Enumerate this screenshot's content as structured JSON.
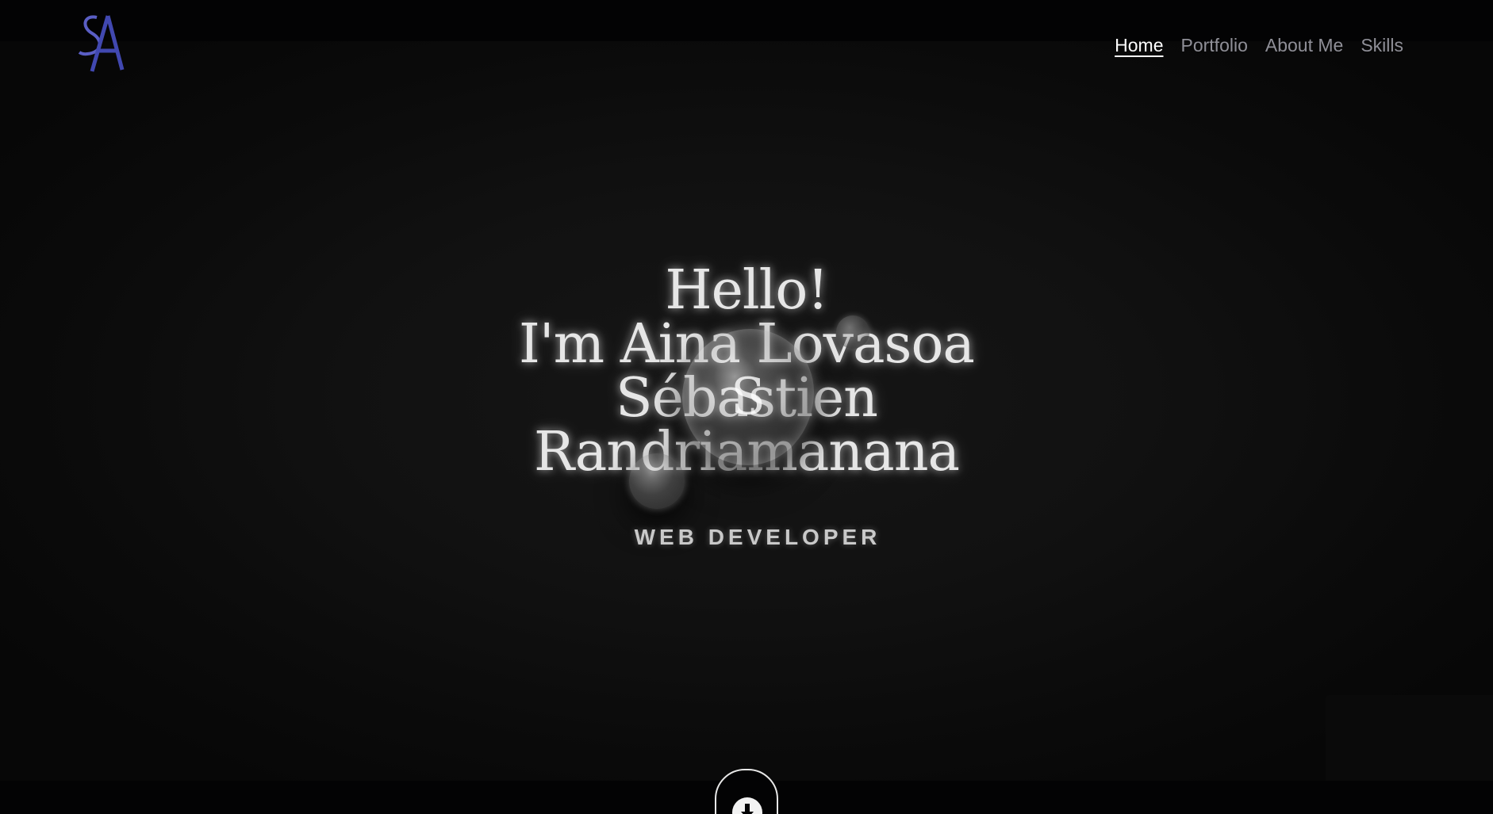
{
  "logo": {
    "letters": "SA",
    "alt_text": "SA"
  },
  "nav": {
    "items": [
      {
        "label": "Home",
        "active": true
      },
      {
        "label": "Portfolio",
        "active": false
      },
      {
        "label": "About Me",
        "active": false
      },
      {
        "label": "Skills",
        "active": false
      }
    ]
  },
  "hero": {
    "title_lines": [
      "Hello!",
      "I'm Aina Lovasoa",
      "Sébastien",
      "Randriamanana"
    ],
    "subtitle": "WEB DEVELOPER",
    "blob_letter": "S"
  },
  "colors": {
    "background": "#030304",
    "logo_accent": "#4b4fb8",
    "nav_inactive": "#8f8f97",
    "nav_active": "#ffffff",
    "title": "#e6e6e6"
  },
  "icons": {
    "scroll": "arrow-down-circle-icon"
  }
}
